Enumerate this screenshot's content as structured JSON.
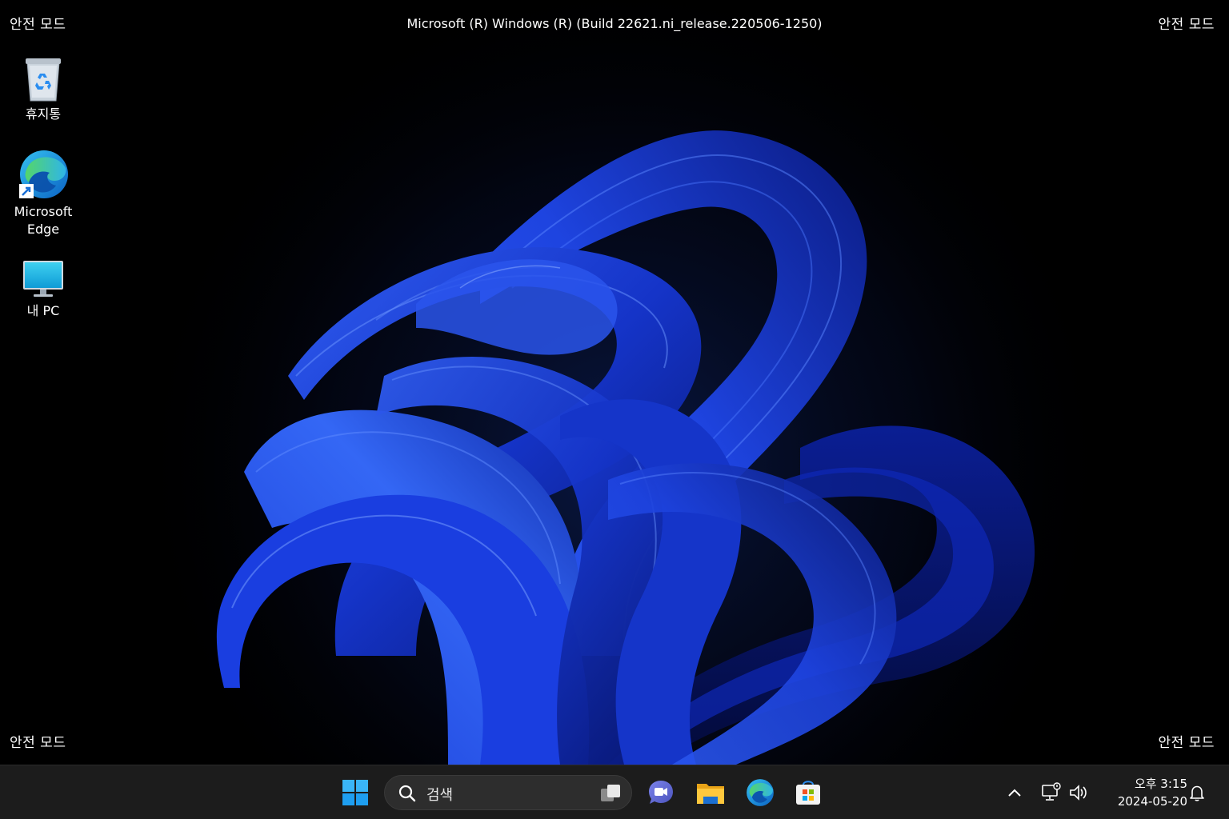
{
  "desktop": {
    "safe_mode_label": "안전 모드",
    "build_info": "Microsoft (R) Windows (R) (Build 22621.ni_release.220506-1250)",
    "icons": [
      {
        "label": "휴지통",
        "icon": "recycle-bin-icon"
      },
      {
        "label": "Microsoft\nEdge",
        "label_line1": "Microsoft",
        "label_line2": "Edge",
        "icon": "edge-icon"
      },
      {
        "label": "내 PC",
        "icon": "this-pc-icon"
      }
    ]
  },
  "taskbar": {
    "search_placeholder": "검색",
    "apps": [
      {
        "name": "start",
        "icon": "windows-start-icon"
      },
      {
        "name": "teams",
        "icon": "teams-chat-icon"
      },
      {
        "name": "file-explorer",
        "icon": "folder-icon"
      },
      {
        "name": "edge",
        "icon": "edge-icon"
      },
      {
        "name": "store",
        "icon": "store-icon"
      }
    ],
    "tray": {
      "time": "오후 3:15",
      "date": "2024-05-20"
    }
  },
  "colors": {
    "taskbar_bg": "#1c1c1c",
    "accent_blue": "#1a3fd8",
    "start_blue": "#33a9f5"
  }
}
